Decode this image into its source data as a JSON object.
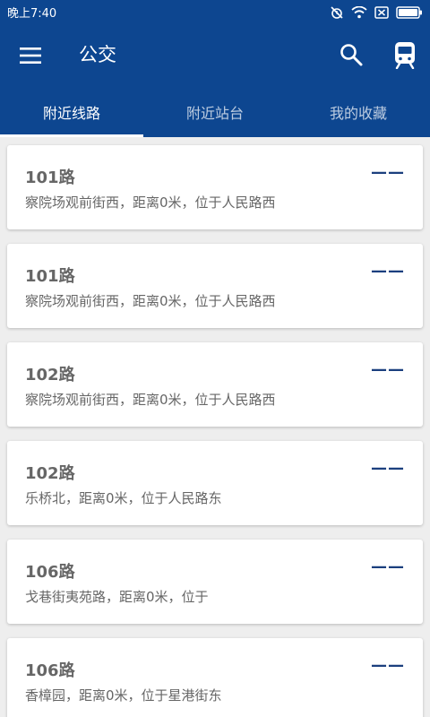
{
  "status_bar": {
    "time": "晚上7:40",
    "icons": [
      "alarm-off-icon",
      "wifi-icon",
      "sim-off-icon",
      "battery-icon"
    ]
  },
  "app_bar": {
    "title": "公交",
    "menu_icon": "menu-icon",
    "search_icon": "search-icon",
    "bus_icon": "bus-icon"
  },
  "tabs": [
    {
      "label": "附近线路",
      "active": true
    },
    {
      "label": "附近站台",
      "active": false
    },
    {
      "label": "我的收藏",
      "active": false
    }
  ],
  "routes": [
    {
      "name": "101路",
      "desc": "察院场观前街西，距离0米，位于人民路西",
      "eta": "——"
    },
    {
      "name": "101路",
      "desc": "察院场观前街西，距离0米，位于人民路西",
      "eta": "——"
    },
    {
      "name": "102路",
      "desc": "察院场观前街西，距离0米，位于人民路西",
      "eta": "——"
    },
    {
      "name": "102路",
      "desc": "乐桥北，距离0米，位于人民路东",
      "eta": "——"
    },
    {
      "name": "106路",
      "desc": "戈巷街夷苑路，距离0米，位于",
      "eta": "——"
    },
    {
      "name": "106路",
      "desc": "香樟园，距离0米，位于星港街东",
      "eta": "——"
    }
  ],
  "colors": {
    "primary": "#0d4690",
    "eta_color": "#1b3f7e",
    "text_grey": "#666666",
    "background": "#eeeeee"
  }
}
